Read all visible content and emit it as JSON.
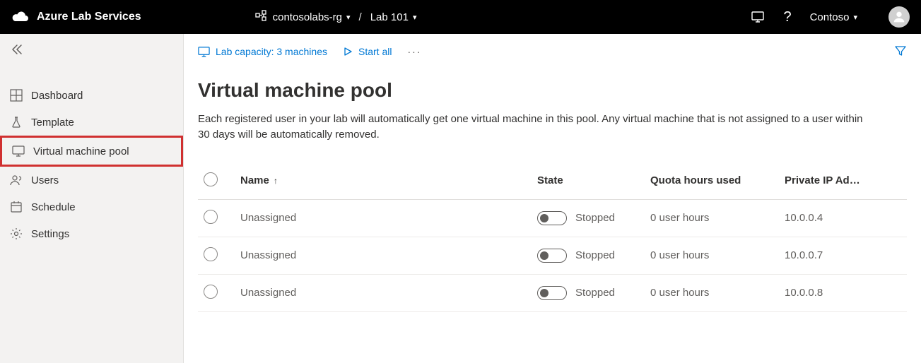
{
  "header": {
    "product_name": "Azure Lab Services",
    "breadcrumb": {
      "rg": "contosolabs-rg",
      "lab": "Lab 101"
    },
    "account_name": "Contoso"
  },
  "sidebar": {
    "items": [
      {
        "label": "Dashboard",
        "icon": "dashboard"
      },
      {
        "label": "Template",
        "icon": "flask"
      },
      {
        "label": "Virtual machine pool",
        "icon": "monitor",
        "active": true
      },
      {
        "label": "Users",
        "icon": "users"
      },
      {
        "label": "Schedule",
        "icon": "calendar"
      },
      {
        "label": "Settings",
        "icon": "gear"
      }
    ]
  },
  "toolbar": {
    "capacity_label": "Lab capacity: 3 machines",
    "start_all_label": "Start all"
  },
  "page": {
    "title": "Virtual machine pool",
    "description": "Each registered user in your lab will automatically get one virtual machine in this pool. Any virtual machine that is not assigned to a user within 30 days will be automatically removed."
  },
  "table": {
    "columns": {
      "name": "Name",
      "state": "State",
      "quota": "Quota hours used",
      "ip": "Private IP Ad…"
    },
    "rows": [
      {
        "name": "Unassigned",
        "state": "Stopped",
        "quota": "0 user hours",
        "ip": "10.0.0.4"
      },
      {
        "name": "Unassigned",
        "state": "Stopped",
        "quota": "0 user hours",
        "ip": "10.0.0.7"
      },
      {
        "name": "Unassigned",
        "state": "Stopped",
        "quota": "0 user hours",
        "ip": "10.0.0.8"
      }
    ]
  }
}
